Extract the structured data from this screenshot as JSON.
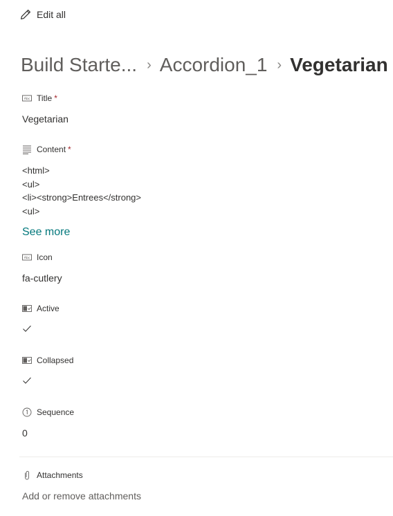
{
  "toolbar": {
    "edit_all_label": "Edit all"
  },
  "breadcrumb": {
    "items": [
      {
        "label": "Build Starte..."
      },
      {
        "label": "Accordion_1"
      },
      {
        "label": "Vegetarian"
      }
    ],
    "separator": "›"
  },
  "fields": {
    "title": {
      "label": "Title",
      "required": "*",
      "value": "Vegetarian",
      "icon": "text-field-icon"
    },
    "content": {
      "label": "Content",
      "required": "*",
      "icon": "multiline-text-icon",
      "value": "<html>\n<ul>\n<li><strong>Entrees</strong>\n<ul>",
      "see_more": "See more"
    },
    "icon": {
      "label": "Icon",
      "value": "fa-cutlery",
      "icon": "text-field-icon"
    },
    "active": {
      "label": "Active",
      "icon": "yes-no-toggle-icon",
      "checked": true
    },
    "collapsed": {
      "label": "Collapsed",
      "icon": "yes-no-toggle-icon",
      "checked": true
    },
    "sequence": {
      "label": "Sequence",
      "value": "0",
      "icon": "number-field-icon"
    },
    "attachments": {
      "label": "Attachments",
      "link": "Add or remove attachments",
      "icon": "paperclip-icon"
    }
  },
  "colors": {
    "text": "#323130",
    "secondary": "#605e5c",
    "link": "#03787c",
    "required": "#a4262c",
    "divider": "#edebe9"
  }
}
